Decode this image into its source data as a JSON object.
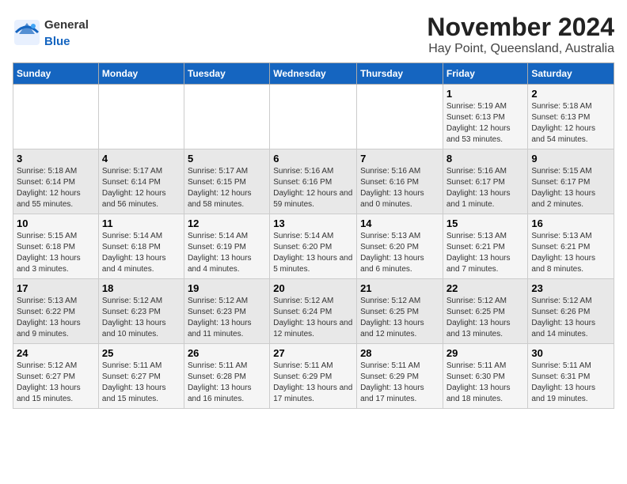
{
  "header": {
    "logo_general": "General",
    "logo_blue": "Blue",
    "title": "November 2024",
    "subtitle": "Hay Point, Queensland, Australia"
  },
  "days_of_week": [
    "Sunday",
    "Monday",
    "Tuesday",
    "Wednesday",
    "Thursday",
    "Friday",
    "Saturday"
  ],
  "weeks": [
    [
      {
        "day": "",
        "info": ""
      },
      {
        "day": "",
        "info": ""
      },
      {
        "day": "",
        "info": ""
      },
      {
        "day": "",
        "info": ""
      },
      {
        "day": "",
        "info": ""
      },
      {
        "day": "1",
        "info": "Sunrise: 5:19 AM\nSunset: 6:13 PM\nDaylight: 12 hours and 53 minutes."
      },
      {
        "day": "2",
        "info": "Sunrise: 5:18 AM\nSunset: 6:13 PM\nDaylight: 12 hours and 54 minutes."
      }
    ],
    [
      {
        "day": "3",
        "info": "Sunrise: 5:18 AM\nSunset: 6:14 PM\nDaylight: 12 hours and 55 minutes."
      },
      {
        "day": "4",
        "info": "Sunrise: 5:17 AM\nSunset: 6:14 PM\nDaylight: 12 hours and 56 minutes."
      },
      {
        "day": "5",
        "info": "Sunrise: 5:17 AM\nSunset: 6:15 PM\nDaylight: 12 hours and 58 minutes."
      },
      {
        "day": "6",
        "info": "Sunrise: 5:16 AM\nSunset: 6:16 PM\nDaylight: 12 hours and 59 minutes."
      },
      {
        "day": "7",
        "info": "Sunrise: 5:16 AM\nSunset: 6:16 PM\nDaylight: 13 hours and 0 minutes."
      },
      {
        "day": "8",
        "info": "Sunrise: 5:16 AM\nSunset: 6:17 PM\nDaylight: 13 hours and 1 minute."
      },
      {
        "day": "9",
        "info": "Sunrise: 5:15 AM\nSunset: 6:17 PM\nDaylight: 13 hours and 2 minutes."
      }
    ],
    [
      {
        "day": "10",
        "info": "Sunrise: 5:15 AM\nSunset: 6:18 PM\nDaylight: 13 hours and 3 minutes."
      },
      {
        "day": "11",
        "info": "Sunrise: 5:14 AM\nSunset: 6:18 PM\nDaylight: 13 hours and 4 minutes."
      },
      {
        "day": "12",
        "info": "Sunrise: 5:14 AM\nSunset: 6:19 PM\nDaylight: 13 hours and 4 minutes."
      },
      {
        "day": "13",
        "info": "Sunrise: 5:14 AM\nSunset: 6:20 PM\nDaylight: 13 hours and 5 minutes."
      },
      {
        "day": "14",
        "info": "Sunrise: 5:13 AM\nSunset: 6:20 PM\nDaylight: 13 hours and 6 minutes."
      },
      {
        "day": "15",
        "info": "Sunrise: 5:13 AM\nSunset: 6:21 PM\nDaylight: 13 hours and 7 minutes."
      },
      {
        "day": "16",
        "info": "Sunrise: 5:13 AM\nSunset: 6:21 PM\nDaylight: 13 hours and 8 minutes."
      }
    ],
    [
      {
        "day": "17",
        "info": "Sunrise: 5:13 AM\nSunset: 6:22 PM\nDaylight: 13 hours and 9 minutes."
      },
      {
        "day": "18",
        "info": "Sunrise: 5:12 AM\nSunset: 6:23 PM\nDaylight: 13 hours and 10 minutes."
      },
      {
        "day": "19",
        "info": "Sunrise: 5:12 AM\nSunset: 6:23 PM\nDaylight: 13 hours and 11 minutes."
      },
      {
        "day": "20",
        "info": "Sunrise: 5:12 AM\nSunset: 6:24 PM\nDaylight: 13 hours and 12 minutes."
      },
      {
        "day": "21",
        "info": "Sunrise: 5:12 AM\nSunset: 6:25 PM\nDaylight: 13 hours and 12 minutes."
      },
      {
        "day": "22",
        "info": "Sunrise: 5:12 AM\nSunset: 6:25 PM\nDaylight: 13 hours and 13 minutes."
      },
      {
        "day": "23",
        "info": "Sunrise: 5:12 AM\nSunset: 6:26 PM\nDaylight: 13 hours and 14 minutes."
      }
    ],
    [
      {
        "day": "24",
        "info": "Sunrise: 5:12 AM\nSunset: 6:27 PM\nDaylight: 13 hours and 15 minutes."
      },
      {
        "day": "25",
        "info": "Sunrise: 5:11 AM\nSunset: 6:27 PM\nDaylight: 13 hours and 15 minutes."
      },
      {
        "day": "26",
        "info": "Sunrise: 5:11 AM\nSunset: 6:28 PM\nDaylight: 13 hours and 16 minutes."
      },
      {
        "day": "27",
        "info": "Sunrise: 5:11 AM\nSunset: 6:29 PM\nDaylight: 13 hours and 17 minutes."
      },
      {
        "day": "28",
        "info": "Sunrise: 5:11 AM\nSunset: 6:29 PM\nDaylight: 13 hours and 17 minutes."
      },
      {
        "day": "29",
        "info": "Sunrise: 5:11 AM\nSunset: 6:30 PM\nDaylight: 13 hours and 18 minutes."
      },
      {
        "day": "30",
        "info": "Sunrise: 5:11 AM\nSunset: 6:31 PM\nDaylight: 13 hours and 19 minutes."
      }
    ]
  ]
}
